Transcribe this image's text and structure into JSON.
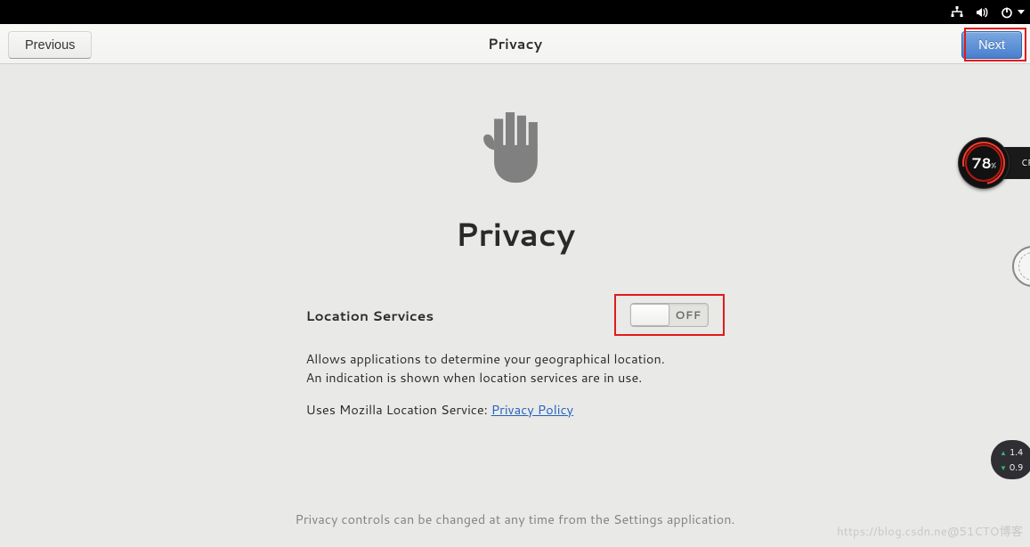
{
  "header": {
    "title": "Privacy",
    "prev_label": "Previous",
    "next_label": "Next"
  },
  "main": {
    "heading": "Privacy",
    "setting_label": "Location Services",
    "switch_state": "OFF",
    "description": "Allows applications to determine your geographical location. An indication is shown when location services are in use.",
    "mozilla_prefix": "Uses Mozilla Location Service: ",
    "privacy_link_label": "Privacy Policy",
    "footer_note": "Privacy controls can be changed at any time from the Settings application."
  },
  "gauge": {
    "value": "78",
    "unit": "%",
    "side_label": "CP"
  },
  "net": {
    "up": "1.4",
    "down": "0.9"
  },
  "watermark": "https://blog.csdn.ne@51CTO博客"
}
